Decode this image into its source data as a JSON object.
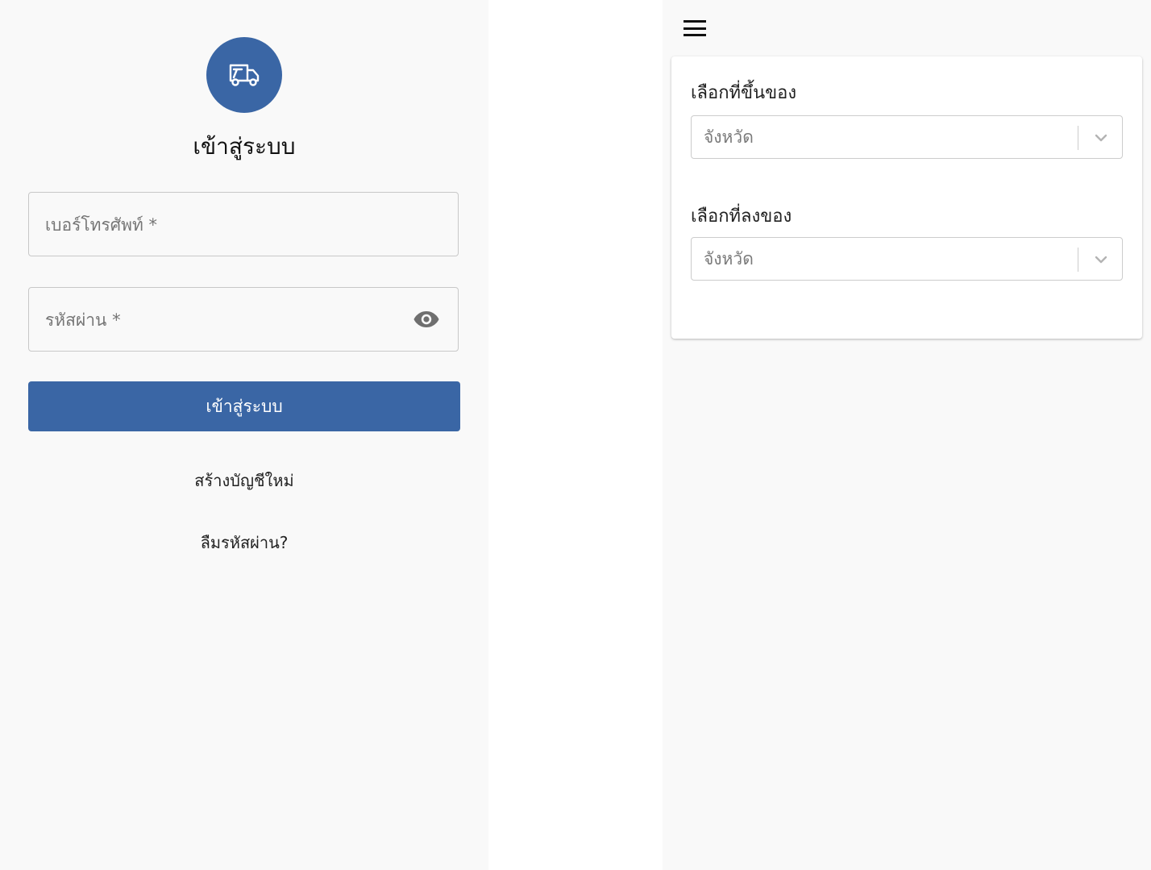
{
  "login": {
    "logo_icon": "truck-icon",
    "title": "เข้าสู่ระบบ",
    "phone_placeholder": "เบอร์โทรศัพท์ *",
    "password_placeholder": "รหัสผ่าน *",
    "show_password_icon": "eye-icon",
    "submit_label": "เข้าสู่ระบบ",
    "create_account_link": "สร้างบัญชีใหม่",
    "forgot_password_link": "ลืมรหัสผ่าน?",
    "accent_color": "#3a66a5"
  },
  "trip_form": {
    "menu_icon": "hamburger-menu-icon",
    "pickup_label": "เลือกที่ขึ้นของ",
    "pickup_select_value": "จังหวัด",
    "dropoff_label": "เลือกที่ลงของ",
    "dropoff_select_value": "จังหวัด",
    "select_chevron_icon": "chevron-down-icon"
  }
}
